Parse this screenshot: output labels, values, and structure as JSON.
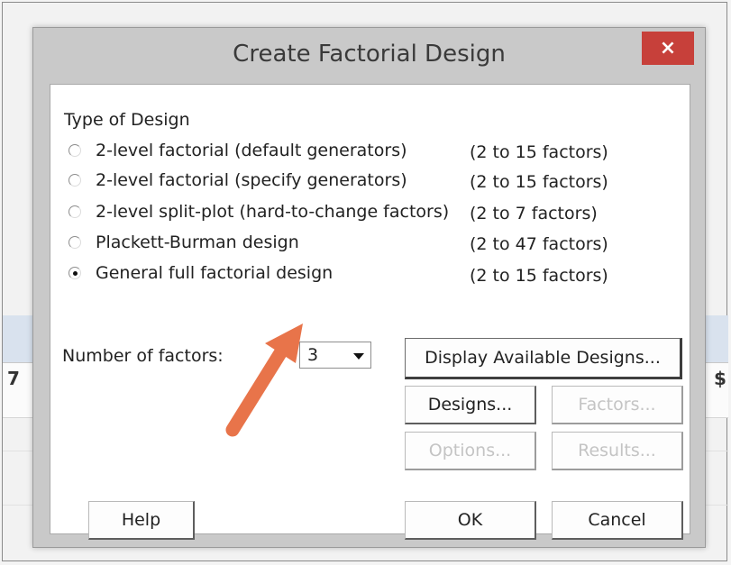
{
  "background": {
    "row_label_left": "7",
    "row_label_right": "$"
  },
  "dialog": {
    "title": "Create Factorial Design",
    "close_glyph": "×",
    "type_of_design_label": "Type of Design",
    "design_options": [
      {
        "label": "2-level factorial (default generators)",
        "range": "(2 to 15 factors)",
        "selected": false
      },
      {
        "label": "2-level factorial (specify generators)",
        "range": "(2 to 15 factors)",
        "selected": false
      },
      {
        "label": "2-level split-plot (hard-to-change factors)",
        "range": "(2 to 7 factors)",
        "selected": false
      },
      {
        "label": "Plackett-Burman design",
        "range": "(2 to 47 factors)",
        "selected": false
      },
      {
        "label": "General full factorial design",
        "range": "(2 to 15 factors)",
        "selected": true
      }
    ],
    "number_of_factors_label": "Number of factors:",
    "number_of_factors_value": "3",
    "buttons": {
      "display_available": "Display Available Designs...",
      "designs": "Designs...",
      "factors": "Factors...",
      "options": "Options...",
      "results": "Results...",
      "help": "Help",
      "ok": "OK",
      "cancel": "Cancel"
    },
    "annotation_arrow_color": "#e8744a",
    "close_button_color": "#c7403a"
  }
}
